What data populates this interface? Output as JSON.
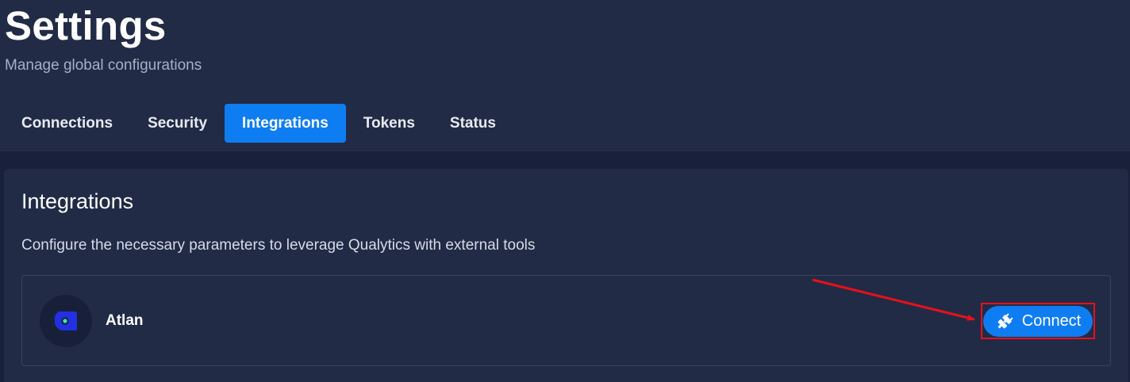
{
  "header": {
    "title": "Settings",
    "subtitle": "Manage global configurations"
  },
  "tabs": [
    {
      "label": "Connections",
      "active": false
    },
    {
      "label": "Security",
      "active": false
    },
    {
      "label": "Integrations",
      "active": true
    },
    {
      "label": "Tokens",
      "active": false
    },
    {
      "label": "Status",
      "active": false
    }
  ],
  "integrations_section": {
    "title": "Integrations",
    "description": "Configure the necessary parameters to leverage Qualytics with external tools",
    "items": [
      {
        "name": "Atlan",
        "logo_icon": "atlan-logo",
        "action_label": "Connect",
        "action_icon": "plug-icon"
      }
    ]
  },
  "annotation": {
    "color": "#e8101b",
    "target": "connect-button"
  },
  "colors": {
    "accent": "#0f7df2",
    "header_bg": "#212b45",
    "page_bg": "#18203a"
  }
}
